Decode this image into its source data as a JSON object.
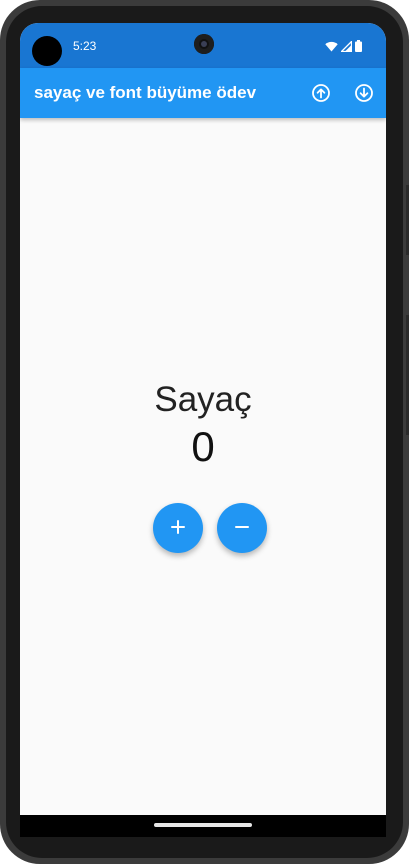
{
  "status_bar": {
    "time": "5:23",
    "icons": [
      "wifi-icon",
      "signal-icon",
      "battery-icon"
    ]
  },
  "app_bar": {
    "title": "sayaç ve font büyüme ödev",
    "actions": [
      "arrow-up-circle-icon",
      "arrow-down-circle-icon"
    ]
  },
  "main": {
    "label": "Sayaç",
    "count": "0",
    "buttons": [
      "plus-icon",
      "minus-icon"
    ]
  },
  "colors": {
    "status_bar": "#1976d2",
    "app_bar": "#2196f3",
    "fab": "#2196f3",
    "background": "#fafafa"
  }
}
